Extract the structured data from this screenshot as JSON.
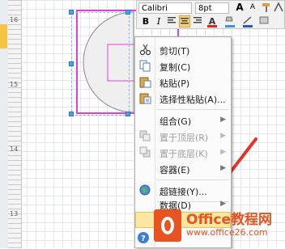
{
  "mini_toolbar": {
    "font_name": "Calibri",
    "font_size": "8pt",
    "grow_font": "A",
    "shrink_font": "A",
    "bold": "B",
    "italic": "I",
    "font_color_glyph": "A"
  },
  "context_menu": {
    "items": [
      {
        "label": "剪切(T)",
        "icon": "scissors-icon",
        "disabled": false
      },
      {
        "label": "复制(C)",
        "icon": "copy-icon",
        "disabled": false
      },
      {
        "label": "粘贴(P)",
        "icon": "paste-icon",
        "disabled": false
      },
      {
        "label": "选择性粘贴(A)...",
        "icon": "paste-special-icon",
        "disabled": false
      },
      {
        "label": "组合(G)",
        "icon": "",
        "disabled": false,
        "submenu": true
      },
      {
        "label": "置于顶层(R)",
        "icon": "bring-to-front-icon",
        "disabled": true,
        "submenu": true
      },
      {
        "label": "置于底层(K)",
        "icon": "send-to-back-icon",
        "disabled": true,
        "submenu": true
      },
      {
        "label": "容器(E)",
        "icon": "",
        "disabled": false,
        "submenu": true
      },
      {
        "label": "超链接(Y)...",
        "icon": "hyperlink-globe-icon",
        "disabled": false
      },
      {
        "label": "数据(D)",
        "icon": "",
        "disabled": false,
        "submenu": true
      }
    ],
    "submenu_arrow": "▶"
  },
  "watermark": {
    "title": "Office教程网",
    "url": "www.office26.com"
  },
  "ruler": {
    "marks": [
      "16",
      "15",
      "14",
      "13"
    ]
  },
  "colors": {
    "selection_magenta": "#e040d8",
    "handle_blue": "#4aa3e8",
    "highlight_amber": "#fbe6a2",
    "arrow_red": "#e2362b",
    "brand_orange": "#e8531f"
  }
}
